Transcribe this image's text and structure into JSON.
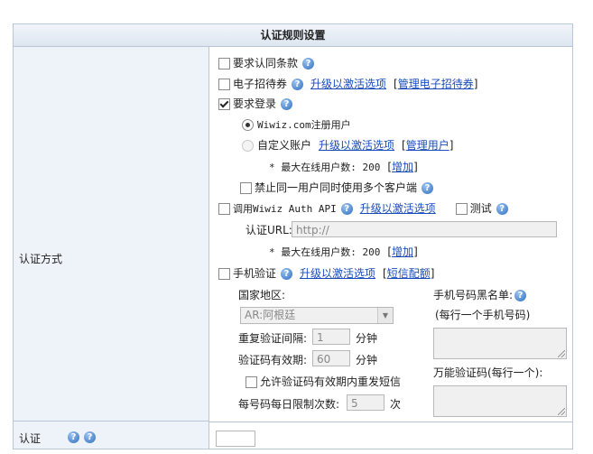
{
  "header": {
    "title": "认证规则设置"
  },
  "left": {
    "auth_method_label": "认证方式",
    "next_label": "认证"
  },
  "opts": {
    "terms": "要求认同条款",
    "ecoupon": "电子招待券",
    "upgrade": "升级以激活选项",
    "manage_ecoupon": "管理电子招待券",
    "require_login": "要求登录",
    "wiwiz_users": "Wiwiz.com注册用户",
    "custom_accounts": "自定义账户",
    "manage_users": "管理用户",
    "max_online_prefix": "* 最大在线用户数: 200",
    "increase": "增加",
    "forbid_multi": "禁止同一用户同时使用多个客户端",
    "call_api": "调用Wiwiz Auth API",
    "test": "测试",
    "auth_url_label": "认证URL:",
    "auth_url_value": "http://",
    "sms": "手机验证",
    "sms_quota": "短信配额"
  },
  "sms": {
    "country_label": "国家地区:",
    "country_value": "AR:阿根廷",
    "retry_interval_label": "重复验证间隔:",
    "retry_interval_value": "1",
    "minutes": "分钟",
    "code_valid_label": "验证码有效期:",
    "code_valid_value": "60",
    "allow_resend": "允许验证码有效期内重发短信",
    "daily_limit_label": "每号码每日限制次数:",
    "daily_limit_value": "5",
    "times": "次",
    "blacklist_label": "手机号码黑名单:",
    "blacklist_hint": "(每行一个手机号码)",
    "universal_code_label": "万能验证码(每行一个):"
  },
  "bracket_open": "[",
  "bracket_close": "]"
}
